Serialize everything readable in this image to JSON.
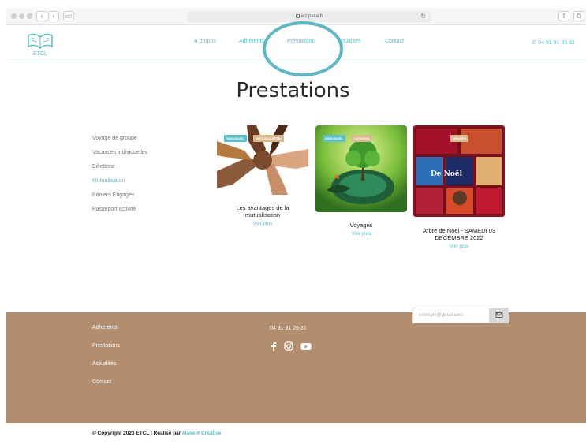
{
  "browser": {
    "url": "etclpaca.fr"
  },
  "header": {
    "logo_text": "ETCL",
    "nav": [
      {
        "label": "À propos"
      },
      {
        "label": "Adhérents"
      },
      {
        "label": "Prestations"
      },
      {
        "label": "Actualités"
      },
      {
        "label": "Contact"
      }
    ],
    "phone": "04 91 91 26 31"
  },
  "main": {
    "title": "Prestations",
    "sidebar": [
      {
        "label": "Voyage de groupe",
        "active": false
      },
      {
        "label": "Vacances individuelles",
        "active": false
      },
      {
        "label": "Billetterie",
        "active": false
      },
      {
        "label": "Mutualisation",
        "active": true
      },
      {
        "label": "Paniers Engagés",
        "active": false
      },
      {
        "label": "Passeport activité",
        "active": false
      }
    ],
    "cards": [
      {
        "tag1": "INDIVIDUEL",
        "tag2": "MUTUALISATION",
        "title": "Les avantages de la mutualisation",
        "link": "Voir plus"
      },
      {
        "tag1": "INDIVIDUEL",
        "tag2": "VOYAGES",
        "title": "Voyages",
        "link": "Voir plus"
      },
      {
        "tag2": "GROUPE",
        "title": "Arbre de Noël - SAMEDI 03 DECEMBRE 2022",
        "link": "Voir plus",
        "image_text": "De Noël"
      }
    ]
  },
  "footer": {
    "links": [
      {
        "label": "Adhérents"
      },
      {
        "label": "Prestations"
      },
      {
        "label": "Actualités"
      },
      {
        "label": "Contact"
      }
    ],
    "phone": "04 91 91 26 31",
    "email_placeholder": "exemple@gmail.com",
    "social": [
      "facebook-icon",
      "instagram-icon",
      "youtube-icon"
    ],
    "copyright_prefix": "© Copyright 2023 ETCL | Réalisé par ",
    "copyright_maker": "Make it Créative"
  },
  "colors": {
    "accent": "#5bc0c8",
    "footer_bg": "#b28e6f",
    "title": "#2b2b2b"
  }
}
